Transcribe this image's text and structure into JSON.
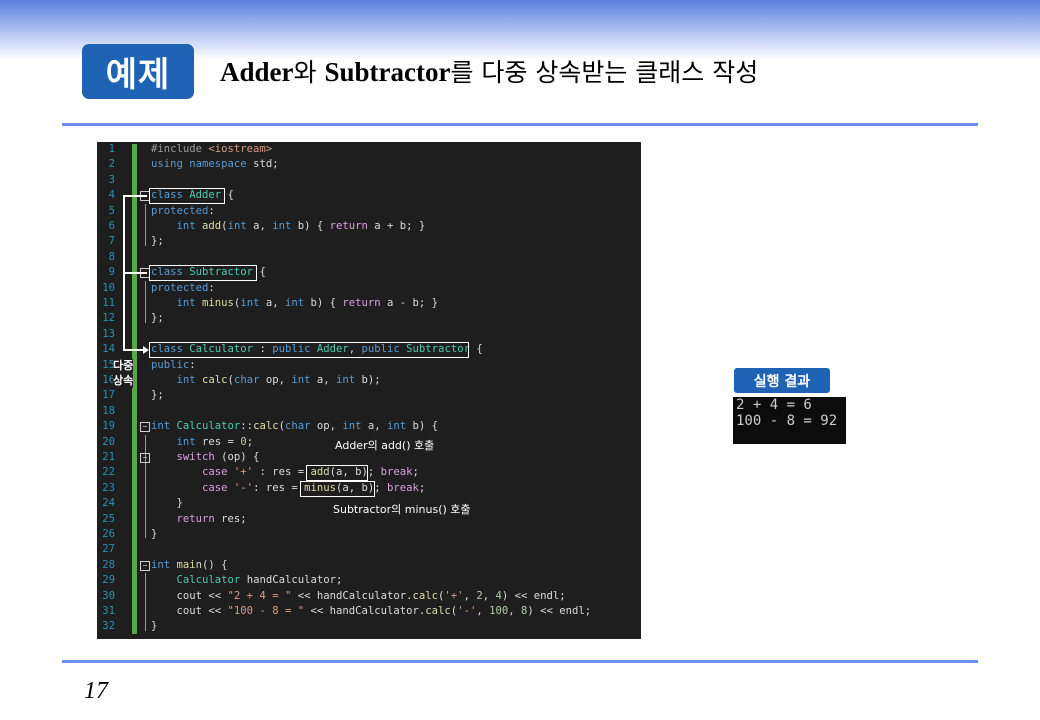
{
  "header": {
    "badge": "예제",
    "title_parts": [
      "Adder",
      "와 ",
      "Subtractor",
      "를 다중 상속받는 클래스 작성"
    ]
  },
  "code": {
    "line_numbers": [
      "1",
      "2",
      "3",
      "4",
      "5",
      "6",
      "7",
      "8",
      "9",
      "10",
      "11",
      "12",
      "13",
      "14",
      "15",
      "16",
      "17",
      "18",
      "19",
      "20",
      "21",
      "22",
      "23",
      "24",
      "25",
      "26",
      "27",
      "28",
      "29",
      "30",
      "31",
      "32"
    ],
    "lines": [
      [
        [
          "pp",
          "#include "
        ],
        [
          "inc",
          "<iostream>"
        ]
      ],
      [
        [
          "kw",
          "using namespace "
        ],
        [
          "",
          "std;"
        ]
      ],
      [],
      [
        [
          "kw",
          "class "
        ],
        [
          "ty",
          "Adder"
        ],
        [
          "",
          " {"
        ]
      ],
      [
        [
          "kw",
          "protected"
        ],
        [
          "",
          ":"
        ]
      ],
      [
        [
          "",
          "    "
        ],
        [
          "kw",
          "int "
        ],
        [
          "fn",
          "add"
        ],
        [
          "",
          "("
        ],
        [
          "kw",
          "int "
        ],
        [
          "",
          "a, "
        ],
        [
          "kw",
          "int "
        ],
        [
          "",
          "b) { "
        ],
        [
          "ctl",
          "return "
        ],
        [
          "",
          "a + b; }"
        ]
      ],
      [
        [
          "",
          "};"
        ]
      ],
      [],
      [
        [
          "kw",
          "class "
        ],
        [
          "ty",
          "Subtractor"
        ],
        [
          "",
          " {"
        ]
      ],
      [
        [
          "kw",
          "protected"
        ],
        [
          "",
          ":"
        ]
      ],
      [
        [
          "",
          "    "
        ],
        [
          "kw",
          "int "
        ],
        [
          "fn",
          "minus"
        ],
        [
          "",
          "("
        ],
        [
          "kw",
          "int "
        ],
        [
          "",
          "a, "
        ],
        [
          "kw",
          "int "
        ],
        [
          "",
          "b) { "
        ],
        [
          "ctl",
          "return "
        ],
        [
          "",
          "a - b; }"
        ]
      ],
      [
        [
          "",
          "};"
        ]
      ],
      [],
      [
        [
          "kw",
          "class "
        ],
        [
          "ty",
          "Calculator"
        ],
        [
          "",
          " : "
        ],
        [
          "kw",
          "public "
        ],
        [
          "ty",
          "Adder"
        ],
        [
          "",
          ", "
        ],
        [
          "kw",
          "public "
        ],
        [
          "ty",
          "Subtractor"
        ],
        [
          "",
          " {"
        ]
      ],
      [
        [
          "kw",
          "public"
        ],
        [
          "",
          ":"
        ]
      ],
      [
        [
          "",
          "    "
        ],
        [
          "kw",
          "int "
        ],
        [
          "fn",
          "calc"
        ],
        [
          "",
          "("
        ],
        [
          "kw",
          "char "
        ],
        [
          "",
          "op, "
        ],
        [
          "kw",
          "int "
        ],
        [
          "",
          "a, "
        ],
        [
          "kw",
          "int "
        ],
        [
          "",
          "b);"
        ]
      ],
      [
        [
          "",
          "};"
        ]
      ],
      [],
      [
        [
          "kw",
          "int "
        ],
        [
          "ty",
          "Calculator"
        ],
        [
          "",
          "::"
        ],
        [
          "fn",
          "calc"
        ],
        [
          "",
          "("
        ],
        [
          "kw",
          "char "
        ],
        [
          "",
          "op, "
        ],
        [
          "kw",
          "int "
        ],
        [
          "",
          "a, "
        ],
        [
          "kw",
          "int "
        ],
        [
          "",
          "b) {"
        ]
      ],
      [
        [
          "",
          "    "
        ],
        [
          "kw",
          "int "
        ],
        [
          "",
          "res = "
        ],
        [
          "num",
          "0"
        ],
        [
          "",
          ";"
        ]
      ],
      [
        [
          "",
          "    "
        ],
        [
          "ctl",
          "switch "
        ],
        [
          "",
          "(op) {"
        ]
      ],
      [
        [
          "",
          "        "
        ],
        [
          "ctl",
          "case "
        ],
        [
          "str",
          "'+'"
        ],
        [
          "",
          " : res = "
        ],
        [
          "fn",
          "add"
        ],
        [
          "",
          "(a, b); "
        ],
        [
          "ctl",
          "break"
        ],
        [
          "",
          ";"
        ]
      ],
      [
        [
          "",
          "        "
        ],
        [
          "ctl",
          "case "
        ],
        [
          "str",
          "'-'"
        ],
        [
          "",
          ": res = "
        ],
        [
          "fn",
          "minus"
        ],
        [
          "",
          "(a, b); "
        ],
        [
          "ctl",
          "break"
        ],
        [
          "",
          ";"
        ]
      ],
      [
        [
          "",
          "    }"
        ]
      ],
      [
        [
          "",
          "    "
        ],
        [
          "ctl",
          "return "
        ],
        [
          "",
          "res;"
        ]
      ],
      [
        [
          "",
          "}"
        ]
      ],
      [],
      [
        [
          "kw",
          "int "
        ],
        [
          "fn",
          "main"
        ],
        [
          "",
          "() {"
        ]
      ],
      [
        [
          "",
          "    "
        ],
        [
          "ty",
          "Calculator "
        ],
        [
          "",
          "handCalculator;"
        ]
      ],
      [
        [
          "",
          "    cout << "
        ],
        [
          "str",
          "\"2 + 4 = \""
        ],
        [
          "",
          " << handCalculator."
        ],
        [
          "fn",
          "calc"
        ],
        [
          "",
          "("
        ],
        [
          "str",
          "'+'"
        ],
        [
          "",
          ", "
        ],
        [
          "num",
          "2"
        ],
        [
          "",
          ", "
        ],
        [
          "num",
          "4"
        ],
        [
          "",
          ") << endl;"
        ]
      ],
      [
        [
          "",
          "    cout << "
        ],
        [
          "str",
          "\"100 - 8 = \""
        ],
        [
          "",
          " << handCalculator."
        ],
        [
          "fn",
          "calc"
        ],
        [
          "",
          "("
        ],
        [
          "str",
          "'-'"
        ],
        [
          "",
          ", "
        ],
        [
          "num",
          "100"
        ],
        [
          "",
          ", "
        ],
        [
          "num",
          "8"
        ],
        [
          "",
          ") << endl;"
        ]
      ],
      [
        [
          "",
          "}"
        ]
      ]
    ]
  },
  "annotations": {
    "inherit_label_1": "다중",
    "inherit_label_2": "상속",
    "adder_call": "Adder의  add()  호출",
    "subtractor_call": "Subtractor의   minus()  호출"
  },
  "result": {
    "label": "실행 결과",
    "lines": [
      "2 + 4 = 6",
      "100 - 8 = 92"
    ]
  },
  "page_number": "17",
  "colors": {
    "badge_bg": "#1f63b5",
    "rule": "#6f8ff0",
    "code_bg": "#1e1e1e",
    "keyword": "#569cd6",
    "type": "#4ec9b0",
    "function": "#dcdcaa",
    "control": "#d8a0df",
    "string": "#d69d85"
  }
}
